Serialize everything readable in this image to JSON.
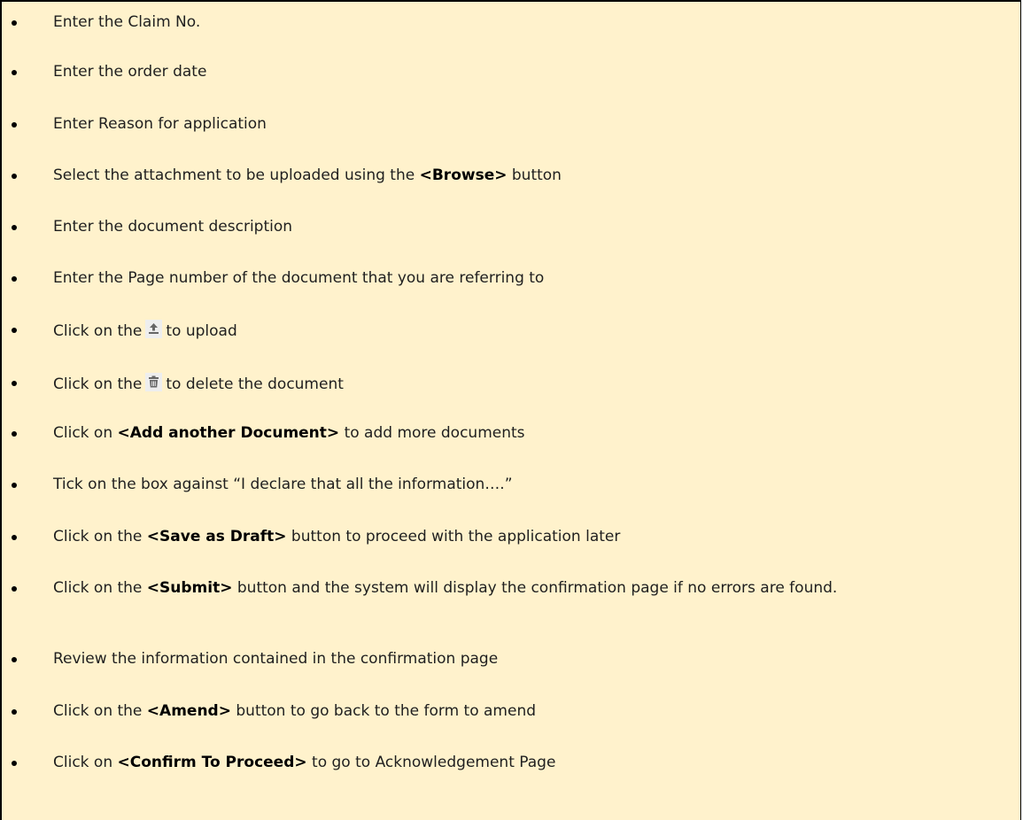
{
  "colors": {
    "background": "#fff2cc",
    "text": "#1f1f1f",
    "border": "#000000",
    "icon_background": "#eeeeee",
    "icon": "#666666"
  },
  "items": [
    {
      "text": "Enter the Claim No."
    },
    {
      "text": "Enter the order date"
    },
    {
      "text": "Enter Reason for application"
    },
    {
      "pre": "Select the attachment to be uploaded using the ",
      "bold": "<Browse>",
      "post": " button"
    },
    {
      "text": "Enter the document description"
    },
    {
      "text": "Enter the Page number of the document that you are referring to"
    },
    {
      "pre": "Click on the",
      "icon": "upload-icon",
      "post": "to upload"
    },
    {
      "pre": "Click on the",
      "icon": "trash-icon",
      "post": "to delete the document"
    },
    {
      "pre": "Click on ",
      "bold": "<Add another Document>",
      "post": " to add more documents"
    },
    {
      "text": "Tick on the box against “I declare that all the information….”"
    },
    {
      "pre": "Click on the ",
      "bold": "<Save as Draft>",
      "post": " button to proceed with the application later"
    },
    {
      "pre": "Click on the ",
      "bold": "<Submit>",
      "post": " button and the system will display the confirmation page if no errors are found."
    },
    {
      "text": "Review the information contained in the confirmation page"
    },
    {
      "pre": "Click on the ",
      "bold": "<Amend>",
      "post": " button to go back to the form to amend"
    },
    {
      "pre": "Click on ",
      "bold": "<Confirm To Proceed>",
      "post": " to go to Acknowledgement Page"
    }
  ]
}
